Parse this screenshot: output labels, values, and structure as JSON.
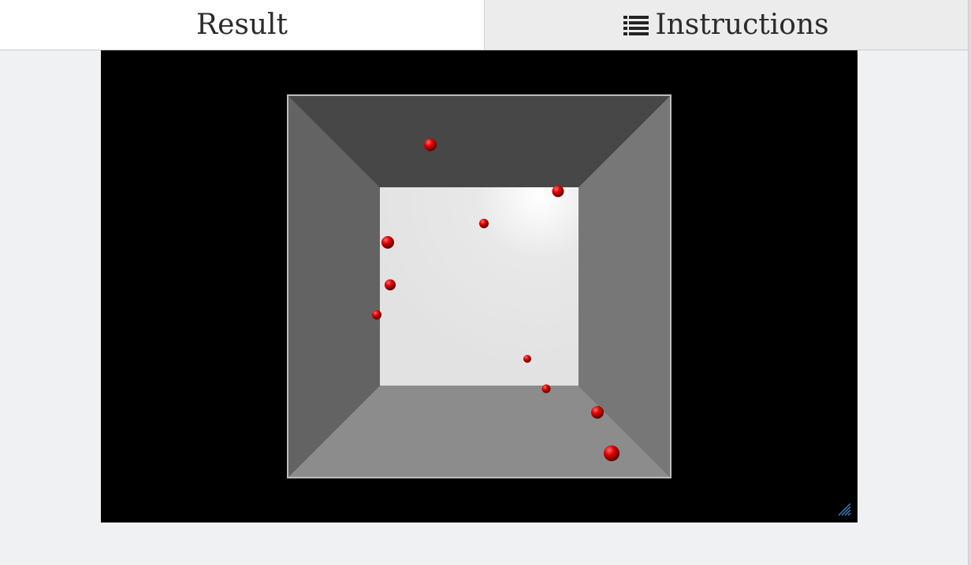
{
  "tabs": {
    "result_label": "Result",
    "instructions_label": "Instructions",
    "instructions_icon": "list-icon"
  },
  "scene": {
    "background": "#000000",
    "box_faces": {
      "top": "#474747",
      "left": "#636363",
      "right": "#777777",
      "bottom": "#8c8c8c",
      "back": "#e6e6e6",
      "edge": "#bdbdbd"
    },
    "ball_color": "#e00000",
    "ball_count": 10
  },
  "resize_handle_icon": "resize-grip-icon"
}
